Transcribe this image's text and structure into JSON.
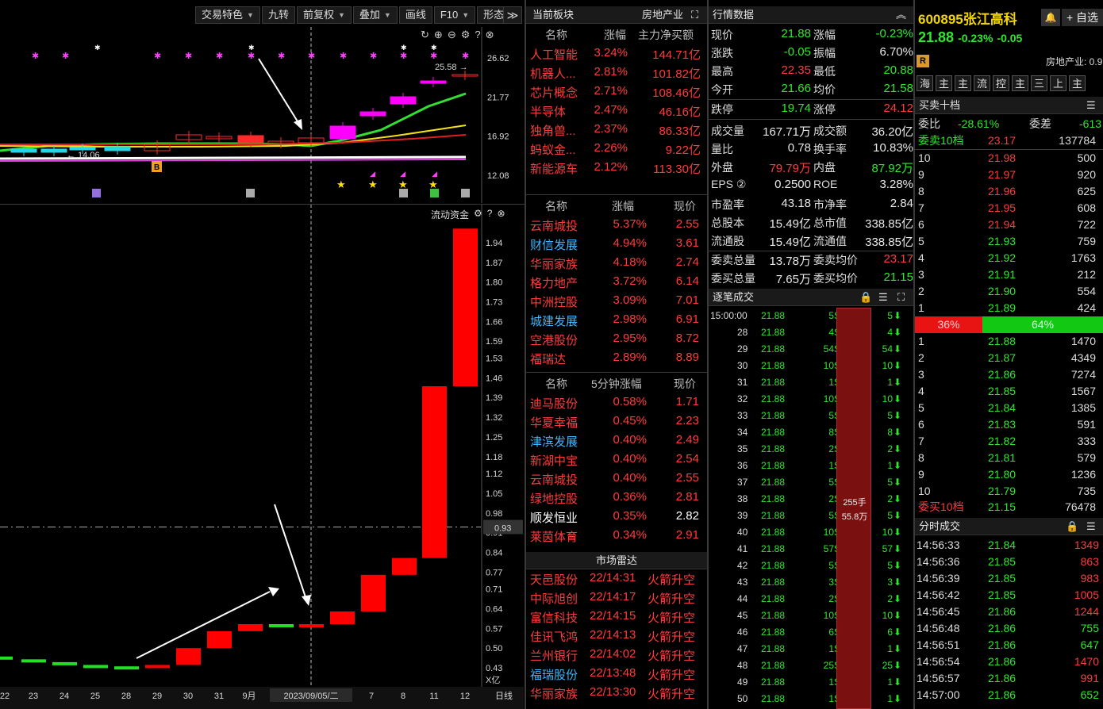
{
  "toolbar": {
    "items": [
      "交易特色",
      "九转",
      "前复权",
      "叠加",
      "画线",
      "F10",
      "形态"
    ],
    "more": "≫"
  },
  "kchart": {
    "yticks": [
      "26.62",
      "21.77",
      "16.92",
      "12.08"
    ],
    "high_label": "25.58",
    "low_label": "14.06",
    "tags": [
      "B"
    ]
  },
  "flow": {
    "title": "流动资金",
    "yticks": [
      "1.94",
      "1.87",
      "1.80",
      "1.73",
      "1.66",
      "1.59",
      "1.53",
      "1.46",
      "1.39",
      "1.32",
      "1.25",
      "1.18",
      "1.12",
      "1.05",
      "0.98",
      "0.91",
      "0.84",
      "0.77",
      "0.71",
      "0.64",
      "0.57",
      "0.50",
      "0.43"
    ],
    "current": "0.93",
    "unit": "X亿",
    "values": [
      0.47,
      0.46,
      0.45,
      0.44,
      0.435,
      0.43,
      0.44,
      0.5,
      0.56,
      0.585,
      0.575,
      0.585,
      0.63,
      0.76,
      0.82,
      1.43,
      1.99
    ],
    "xlabels": [
      "22",
      "23",
      "24",
      "25",
      "28",
      "29",
      "30",
      "31",
      "9月",
      "2023/09/05/二",
      "7",
      "8",
      "11",
      "12",
      "日线"
    ]
  },
  "sector": {
    "title": "当前板块",
    "name": "房地产业",
    "headers": [
      "名称",
      "涨幅",
      "主力净买额"
    ],
    "rows": [
      {
        "name": "人工智能",
        "chg": "3.24%",
        "amt": "144.71亿"
      },
      {
        "name": "机器人...",
        "chg": "2.81%",
        "amt": "101.82亿"
      },
      {
        "name": "芯片概念",
        "chg": "2.71%",
        "amt": "108.46亿"
      },
      {
        "name": "半导体",
        "chg": "2.47%",
        "amt": "46.16亿"
      },
      {
        "name": "独角兽...",
        "chg": "2.37%",
        "amt": "86.33亿"
      },
      {
        "name": "蚂蚁金...",
        "chg": "2.26%",
        "amt": "9.22亿"
      },
      {
        "name": "新能源车",
        "chg": "2.12%",
        "amt": "113.30亿"
      }
    ]
  },
  "rank": {
    "headers": [
      "名称",
      "涨幅",
      "现价"
    ],
    "rows": [
      {
        "name": "云南城投",
        "chg": "5.37%",
        "price": "2.55",
        "color": "#ff3b3b"
      },
      {
        "name": "财信发展",
        "chg": "4.94%",
        "price": "3.61",
        "color": "#3fb6ff"
      },
      {
        "name": "华丽家族",
        "chg": "4.18%",
        "price": "2.74",
        "color": "#ff3b3b"
      },
      {
        "name": "格力地产",
        "chg": "3.72%",
        "price": "6.14",
        "color": "#ff3b3b"
      },
      {
        "name": "中洲控股",
        "chg": "3.09%",
        "price": "7.01",
        "color": "#ff3b3b"
      },
      {
        "name": "城建发展",
        "chg": "2.98%",
        "price": "6.91",
        "color": "#3fb6ff"
      },
      {
        "name": "空港股份",
        "chg": "2.95%",
        "price": "8.72",
        "color": "#ff3b3b"
      },
      {
        "name": "福瑞达",
        "chg": "2.89%",
        "price": "8.89",
        "color": "#ff3b3b"
      }
    ]
  },
  "rank5": {
    "headers": [
      "名称",
      "5分钟涨幅",
      "现价"
    ],
    "rows": [
      {
        "name": "迪马股份",
        "chg": "0.58%",
        "price": "1.71",
        "color": "#ff3b3b"
      },
      {
        "name": "华夏幸福",
        "chg": "0.45%",
        "price": "2.23",
        "color": "#ff3b3b"
      },
      {
        "name": "津滨发展",
        "chg": "0.40%",
        "price": "2.49",
        "color": "#3fb6ff"
      },
      {
        "name": "新湖中宝",
        "chg": "0.40%",
        "price": "2.54",
        "color": "#ff3b3b"
      },
      {
        "name": "云南城投",
        "chg": "0.40%",
        "price": "2.55",
        "color": "#ff3b3b"
      },
      {
        "name": "绿地控股",
        "chg": "0.36%",
        "price": "2.81",
        "color": "#ff3b3b"
      },
      {
        "name": "顺发恒业",
        "chg": "0.35%",
        "price": "2.82",
        "color": "#ffffff"
      },
      {
        "name": "莱茵体育",
        "chg": "0.34%",
        "price": "2.91",
        "color": "#ff3b3b"
      }
    ]
  },
  "radar": {
    "title": "市场雷达",
    "rows": [
      {
        "name": "天邑股份",
        "time": "22/14:31",
        "event": "火箭升空",
        "color": "#ff3b3b"
      },
      {
        "name": "中际旭创",
        "time": "22/14:17",
        "event": "火箭升空",
        "color": "#ff3b3b"
      },
      {
        "name": "富信科技",
        "time": "22/14:15",
        "event": "火箭升空",
        "color": "#ff3b3b"
      },
      {
        "name": "佳讯飞鸿",
        "time": "22/14:13",
        "event": "火箭升空",
        "color": "#ff3b3b"
      },
      {
        "name": "兰州银行",
        "time": "22/14:02",
        "event": "火箭升空",
        "color": "#ff3b3b"
      },
      {
        "name": "福瑞股份",
        "time": "22/13:48",
        "event": "火箭升空",
        "color": "#3fb6ff"
      },
      {
        "name": "华丽家族",
        "time": "22/13:30",
        "event": "火箭升空",
        "color": "#ff3b3b"
      }
    ]
  },
  "quote": {
    "title": "行情数据",
    "rows": [
      [
        {
          "l": "现价",
          "v": "21.88",
          "c": "#2ee82e"
        },
        {
          "l": "涨幅",
          "v": "-0.23%",
          "c": "#2ee82e"
        }
      ],
      [
        {
          "l": "涨跌",
          "v": "-0.05",
          "c": "#2ee82e"
        },
        {
          "l": "振幅",
          "v": "6.70%",
          "c": "#e8e8e8"
        }
      ],
      [
        {
          "l": "最高",
          "v": "22.35",
          "c": "#ff3b3b"
        },
        {
          "l": "最低",
          "v": "20.88",
          "c": "#2ee82e"
        }
      ],
      [
        {
          "l": "今开",
          "v": "21.66",
          "c": "#2ee82e"
        },
        {
          "l": "均价",
          "v": "21.58",
          "c": "#2ee82e"
        }
      ],
      [
        {
          "l": "跌停",
          "v": "19.74",
          "c": "#2ee82e"
        },
        {
          "l": "涨停",
          "v": "24.12",
          "c": "#ff3b3b"
        }
      ],
      [
        {
          "l": "成交量",
          "v": "167.71万",
          "c": "#e8e8e8"
        },
        {
          "l": "成交额",
          "v": "36.20亿",
          "c": "#e8e8e8"
        }
      ],
      [
        {
          "l": "量比",
          "v": "0.78",
          "c": "#e8e8e8"
        },
        {
          "l": "换手率",
          "v": "10.83%",
          "c": "#e8e8e8"
        }
      ],
      [
        {
          "l": "外盘",
          "v": "79.79万",
          "c": "#ff3b3b"
        },
        {
          "l": "内盘",
          "v": "87.92万",
          "c": "#2ee82e"
        }
      ],
      [
        {
          "l": "EPS ②",
          "v": "0.2500",
          "c": "#e8e8e8"
        },
        {
          "l": "ROE",
          "v": "3.28%",
          "c": "#e8e8e8"
        }
      ],
      [
        {
          "l": "市盈率",
          "v": "43.18",
          "c": "#e8e8e8"
        },
        {
          "l": "市净率",
          "v": "2.84",
          "c": "#e8e8e8"
        }
      ],
      [
        {
          "l": "总股本",
          "v": "15.49亿",
          "c": "#e8e8e8"
        },
        {
          "l": "总市值",
          "v": "338.85亿",
          "c": "#e8e8e8"
        }
      ],
      [
        {
          "l": "流通股",
          "v": "15.49亿",
          "c": "#e8e8e8"
        },
        {
          "l": "流通值",
          "v": "338.85亿",
          "c": "#e8e8e8"
        }
      ],
      [
        {
          "l": "委卖总量",
          "v": "13.78万",
          "c": "#e8e8e8"
        },
        {
          "l": "委卖均价",
          "v": "23.17",
          "c": "#ff3b3b"
        }
      ],
      [
        {
          "l": "委买总量",
          "v": "7.65万",
          "c": "#e8e8e8"
        },
        {
          "l": "委买均价",
          "v": "21.15",
          "c": "#2ee82e"
        }
      ]
    ]
  },
  "ticks": {
    "title": "逐笔成交",
    "first_time": "15:00:00",
    "rows": [
      {
        "t": "28",
        "p": "21.88",
        "v": "4",
        "s": "4"
      },
      {
        "t": "29",
        "p": "21.88",
        "v": "54",
        "s": "54"
      },
      {
        "t": "30",
        "p": "21.88",
        "v": "10",
        "s": "10"
      },
      {
        "t": "31",
        "p": "21.88",
        "v": "1",
        "s": "1"
      },
      {
        "t": "32",
        "p": "21.88",
        "v": "10",
        "s": "10"
      },
      {
        "t": "33",
        "p": "21.88",
        "v": "5",
        "s": "5"
      },
      {
        "t": "34",
        "p": "21.88",
        "v": "8",
        "s": "8"
      },
      {
        "t": "35",
        "p": "21.88",
        "v": "2",
        "s": "2"
      },
      {
        "t": "36",
        "p": "21.88",
        "v": "1",
        "s": "1"
      },
      {
        "t": "37",
        "p": "21.88",
        "v": "5",
        "s": "5"
      },
      {
        "t": "38",
        "p": "21.88",
        "v": "2",
        "s": "2"
      },
      {
        "t": "39",
        "p": "21.88",
        "v": "5",
        "s": "5"
      },
      {
        "t": "40",
        "p": "21.88",
        "v": "10",
        "s": "10"
      },
      {
        "t": "41",
        "p": "21.88",
        "v": "57",
        "s": "57"
      },
      {
        "t": "42",
        "p": "21.88",
        "v": "5",
        "s": "5"
      },
      {
        "t": "43",
        "p": "21.88",
        "v": "3",
        "s": "3"
      },
      {
        "t": "44",
        "p": "21.88",
        "v": "2",
        "s": "2"
      },
      {
        "t": "45",
        "p": "21.88",
        "v": "10",
        "s": "10"
      },
      {
        "t": "46",
        "p": "21.88",
        "v": "6",
        "s": "6"
      },
      {
        "t": "47",
        "p": "21.88",
        "v": "1",
        "s": "1"
      },
      {
        "t": "48",
        "p": "21.88",
        "v": "25",
        "s": "25"
      },
      {
        "t": "49",
        "p": "21.88",
        "v": "1",
        "s": "1"
      },
      {
        "t": "50",
        "p": "21.88",
        "v": "1",
        "s": "1"
      }
    ],
    "first": {
      "p": "21.88",
      "v": "5",
      "s": "5"
    },
    "block_vol": "255手",
    "block_amt": "55.8万"
  },
  "stock": {
    "code": "600895",
    "name": "张江高科",
    "price": "21.88",
    "change_pct": "-0.23%",
    "change": "-0.05",
    "alert": "🔔",
    "watch": "+ 自选",
    "industry": "房地产业: 0.9",
    "tag_r": "R",
    "chips": [
      "海",
      "主",
      "主",
      "流",
      "控",
      "主",
      "三",
      "上",
      "主"
    ]
  },
  "book": {
    "title": "买卖十档",
    "weibi_label": "委比",
    "weibi": "-28.61%",
    "weicha_label": "委差",
    "weicha": "-613",
    "sell10_label": "委卖10档",
    "sell10_price": "23.17",
    "sell10_vol": "137784",
    "asks": [
      {
        "n": "10",
        "p": "21.98",
        "v": "500"
      },
      {
        "n": "9",
        "p": "21.97",
        "v": "920"
      },
      {
        "n": "8",
        "p": "21.96",
        "v": "625"
      },
      {
        "n": "7",
        "p": "21.95",
        "v": "608"
      },
      {
        "n": "6",
        "p": "21.94",
        "v": "722"
      },
      {
        "n": "5",
        "p": "21.93",
        "v": "759"
      },
      {
        "n": "4",
        "p": "21.92",
        "v": "1763"
      },
      {
        "n": "3",
        "p": "21.91",
        "v": "212"
      },
      {
        "n": "2",
        "p": "21.90",
        "v": "554"
      },
      {
        "n": "1",
        "p": "21.89",
        "v": "424"
      }
    ],
    "sell_ratio": "36%",
    "buy_ratio": "64%",
    "sell_ratio_value": 36,
    "bids": [
      {
        "n": "1",
        "p": "21.88",
        "v": "1470"
      },
      {
        "n": "2",
        "p": "21.87",
        "v": "4349"
      },
      {
        "n": "3",
        "p": "21.86",
        "v": "7274"
      },
      {
        "n": "4",
        "p": "21.85",
        "v": "1567"
      },
      {
        "n": "5",
        "p": "21.84",
        "v": "1385"
      },
      {
        "n": "6",
        "p": "21.83",
        "v": "591"
      },
      {
        "n": "7",
        "p": "21.82",
        "v": "333"
      },
      {
        "n": "8",
        "p": "21.81",
        "v": "579"
      },
      {
        "n": "9",
        "p": "21.80",
        "v": "1236"
      },
      {
        "n": "10",
        "p": "21.79",
        "v": "735"
      }
    ],
    "buy10_label": "委买10档",
    "buy10_price": "21.15",
    "buy10_vol": "76478"
  },
  "timesales": {
    "title": "分时成交",
    "rows": [
      {
        "t": "14:56:33",
        "p": "21.84",
        "v": "1349",
        "pc": "#2ee82e",
        "vc": "#ff3b3b"
      },
      {
        "t": "14:56:36",
        "p": "21.85",
        "v": "863",
        "pc": "#2ee82e",
        "vc": "#ff3b3b"
      },
      {
        "t": "14:56:39",
        "p": "21.85",
        "v": "983",
        "pc": "#2ee82e",
        "vc": "#ff3b3b"
      },
      {
        "t": "14:56:42",
        "p": "21.85",
        "v": "1005",
        "pc": "#2ee82e",
        "vc": "#ff3b3b"
      },
      {
        "t": "14:56:45",
        "p": "21.86",
        "v": "1244",
        "pc": "#2ee82e",
        "vc": "#ff3b3b"
      },
      {
        "t": "14:56:48",
        "p": "21.86",
        "v": "755",
        "pc": "#2ee82e",
        "vc": "#2ee82e"
      },
      {
        "t": "14:56:51",
        "p": "21.86",
        "v": "647",
        "pc": "#2ee82e",
        "vc": "#2ee82e"
      },
      {
        "t": "14:56:54",
        "p": "21.86",
        "v": "1470",
        "pc": "#2ee82e",
        "vc": "#ff3b3b"
      },
      {
        "t": "14:56:57",
        "p": "21.86",
        "v": "991",
        "pc": "#2ee82e",
        "vc": "#ff3b3b"
      },
      {
        "t": "14:57:00",
        "p": "21.86",
        "v": "652",
        "pc": "#2ee82e",
        "vc": "#2ee82e"
      }
    ]
  },
  "colors": {
    "up": "#ff3b3b",
    "down": "#2ee82e",
    "blue": "#3fb6ff",
    "bg": "#000000"
  }
}
